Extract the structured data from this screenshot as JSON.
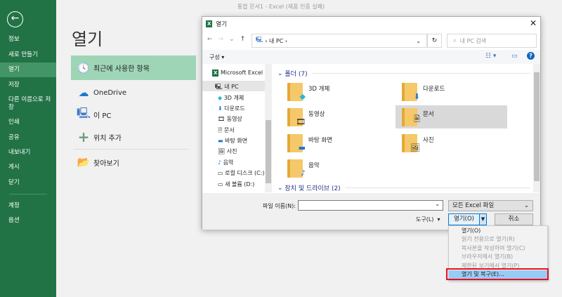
{
  "app_title": "통합 문서1 - Excel (제품 인증 실패)",
  "sidebar": {
    "items": [
      {
        "label": "정보"
      },
      {
        "label": "새로 만들기"
      },
      {
        "label": "열기",
        "active": true
      },
      {
        "label": "저장"
      },
      {
        "label": "다른 이름으로 저장"
      },
      {
        "label": "인쇄"
      },
      {
        "label": "공유"
      },
      {
        "label": "내보내기"
      },
      {
        "label": "게시"
      },
      {
        "label": "닫기"
      },
      {
        "label": "계정"
      },
      {
        "label": "옵션"
      }
    ]
  },
  "main": {
    "title": "열기",
    "options": [
      {
        "label": "최근에 사용한 항목",
        "icon": "clock-icon"
      },
      {
        "label": "OneDrive",
        "icon": "cloud-icon"
      },
      {
        "label": "이 PC",
        "icon": "computer-icon"
      },
      {
        "label": "위치 추가",
        "icon": "plus-icon"
      },
      {
        "label": "찾아보기",
        "icon": "folder-open-icon"
      }
    ]
  },
  "dialog": {
    "title": "열기",
    "address": "내 PC",
    "search_placeholder": "내 PC 검색",
    "organize": "구성",
    "nav": [
      "Microsoft Excel",
      "내 PC",
      "3D 개체",
      "다운로드",
      "동영상",
      "문서",
      "바탕 화면",
      "사진",
      "음악",
      "로컬 디스크 (C:)",
      "새 볼륨 (D:)"
    ],
    "folders_header": "폴더 (7)",
    "folders": [
      "3D 개체",
      "다운로드",
      "동영상",
      "문서",
      "바탕 화면",
      "사진",
      "음악"
    ],
    "selected_folder": "문서",
    "drives_header": "장치 및 드라이브 (2)",
    "filename_label": "파일 이름(N):",
    "filename_value": "",
    "filter": "모든 Excel 파일",
    "tools": "도구(L)",
    "open": "열기(O)",
    "cancel": "취소",
    "menu": [
      "열기(O)",
      "읽기 전용으로 열기(R)",
      "복사본을 작성하여 열기(C)",
      "브라우저에서 열기(B)",
      "제한된 보기에서 열기(P)",
      "열기 및 복구(E)..."
    ],
    "highlight_color": "#99ccf5",
    "callout_color": "#e81123"
  },
  "colors": {
    "sidebar": "#217346",
    "recent_highlight": "#9fd5b7"
  }
}
